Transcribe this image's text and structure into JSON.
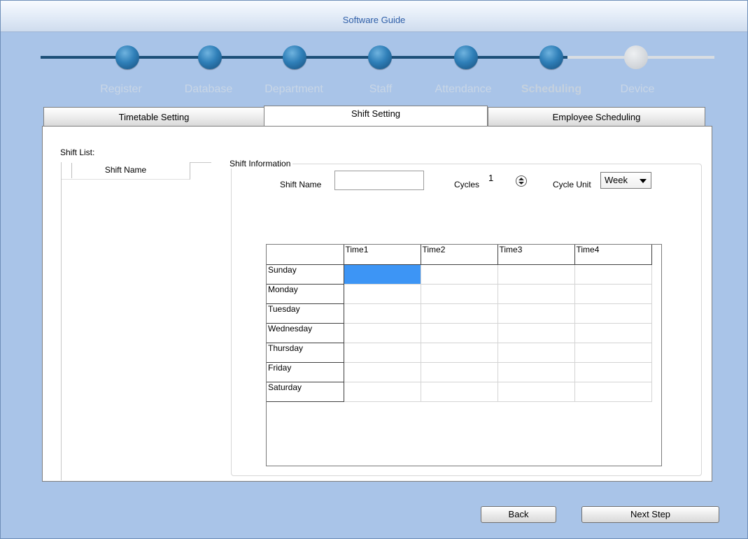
{
  "window": {
    "title": "Software Guide"
  },
  "steps": [
    {
      "label": "Register",
      "state": "done"
    },
    {
      "label": "Database",
      "state": "done"
    },
    {
      "label": "Department",
      "state": "done"
    },
    {
      "label": "Staff",
      "state": "done"
    },
    {
      "label": "Attendance",
      "state": "done"
    },
    {
      "label": "Scheduling",
      "state": "active"
    },
    {
      "label": "Device",
      "state": "todo"
    }
  ],
  "tabs": [
    {
      "label": "Timetable Setting",
      "selected": false
    },
    {
      "label": "Shift Setting",
      "selected": true
    },
    {
      "label": "Employee Scheduling",
      "selected": false
    }
  ],
  "shift_list": {
    "label": "Shift List:",
    "column": "Shift Name"
  },
  "shift_info": {
    "group_label": "Shift Information",
    "shift_name_label": "Shift Name",
    "shift_name_value": "",
    "cycles_label": "Cycles",
    "cycles_value": "1",
    "cycle_unit_label": "Cycle Unit",
    "cycle_unit_value": "Week"
  },
  "grid": {
    "columns": [
      "Time1",
      "Time2",
      "Time3",
      "Time4"
    ],
    "rows": [
      "Sunday",
      "Monday",
      "Tuesday",
      "Wednesday",
      "Thursday",
      "Friday",
      "Saturday"
    ],
    "selected_cell": {
      "row": "Sunday",
      "column": "Time1"
    }
  },
  "buttons": {
    "back": "Back",
    "next": "Next Step"
  },
  "colors": {
    "step_done": "#1c4f78",
    "step_todo": "#d9dde2",
    "selection": "#3d95f5",
    "background": "#a9c4e8"
  }
}
